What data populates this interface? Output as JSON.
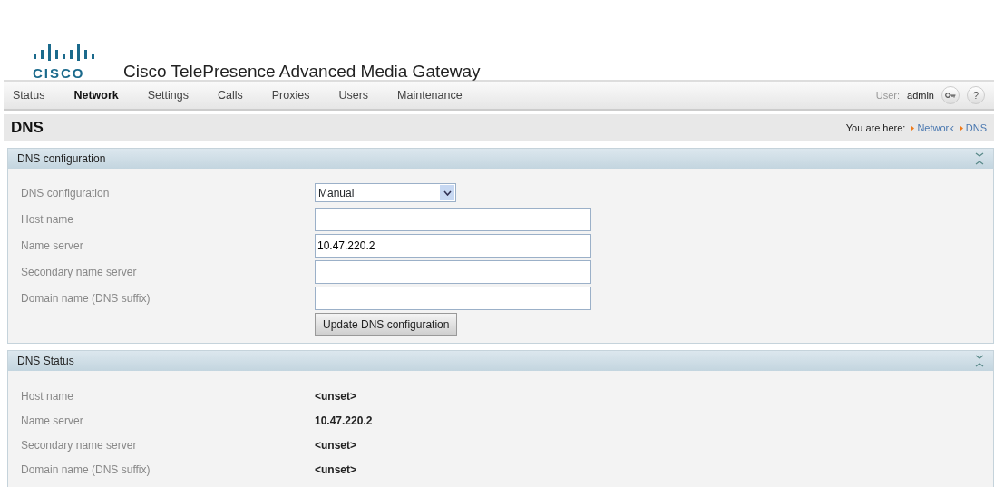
{
  "logo": {
    "wordmark": "CISCO"
  },
  "product_title": "Cisco TelePresence Advanced Media Gateway",
  "nav": [
    {
      "label": "Status",
      "selected": false
    },
    {
      "label": "Network",
      "selected": true
    },
    {
      "label": "Settings",
      "selected": false
    },
    {
      "label": "Calls",
      "selected": false
    },
    {
      "label": "Proxies",
      "selected": false
    },
    {
      "label": "Users",
      "selected": false
    },
    {
      "label": "Maintenance",
      "selected": false
    }
  ],
  "user": {
    "label": "User:",
    "name": "admin",
    "help": "?"
  },
  "page_title": "DNS",
  "breadcrumb": {
    "label": "You are here:",
    "items": [
      "Network",
      "DNS"
    ]
  },
  "config_section": {
    "title": "DNS configuration",
    "fields": [
      {
        "label": "DNS configuration",
        "kind": "select",
        "value": "Manual"
      },
      {
        "label": "Host name",
        "kind": "text"
      },
      {
        "label": "Name server",
        "kind": "text",
        "value": "10.47.220.2"
      },
      {
        "label": "Secondary name server",
        "kind": "text"
      },
      {
        "label": "Domain name (DNS suffix)",
        "kind": "text"
      }
    ],
    "button": "Update DNS configuration"
  },
  "status_section": {
    "title": "DNS Status",
    "rows": [
      {
        "label": "Host name",
        "value": "<unset>"
      },
      {
        "label": "Name server",
        "value": "10.47.220.2"
      },
      {
        "label": "Secondary name server",
        "value": "<unset>"
      },
      {
        "label": "Domain name (DNS suffix)",
        "value": "<unset>"
      }
    ]
  }
}
